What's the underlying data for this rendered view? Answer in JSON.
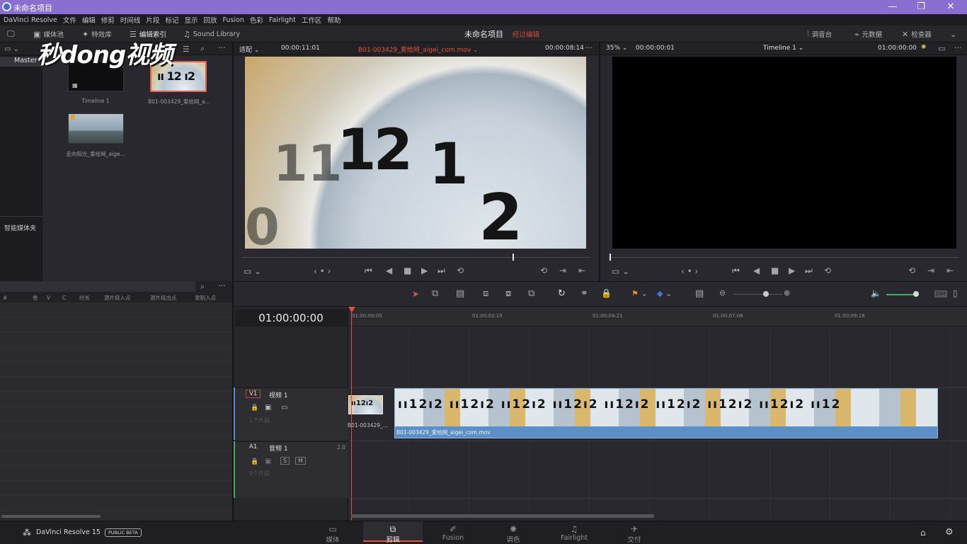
{
  "window": {
    "title": "未命名项目"
  },
  "menu": [
    "DaVinci Resolve",
    "文件",
    "编辑",
    "修剪",
    "时间线",
    "片段",
    "标记",
    "显示",
    "回放",
    "Fusion",
    "色彩",
    "Fairlight",
    "工作区",
    "帮助"
  ],
  "toolbar": {
    "media_pool": "媒体池",
    "effects": "特效库",
    "edit_index": "编辑索引",
    "sound_library": "Sound Library",
    "project": "未命名项目",
    "edited": "经过编辑",
    "mixer": "调音台",
    "metadata": "元数据",
    "inspector": "检查器"
  },
  "watermark": "秒懂视频",
  "bins": {
    "master": "Master",
    "smart": "智能媒体夹"
  },
  "media": [
    {
      "name": "Timeline 1"
    },
    {
      "name": "B01-003429_爱给网_a..."
    },
    {
      "name": "走向阳光_爱给网_aige..."
    }
  ],
  "source": {
    "fit": "适配",
    "tc": "00:00:11:01",
    "clip": "B01-003429_爱给网_aigei_com.mov",
    "dur": "00:00:08:14",
    "zoom": "35%",
    "tc2": "00:00:00:01"
  },
  "program": {
    "name": "Timeline 1",
    "tc": "01:00:00:00"
  },
  "edit_index_cols": [
    "#",
    "卷",
    "V",
    "C",
    "时长",
    "源片段入点",
    "源片段出点",
    "录制入点"
  ],
  "timeline": {
    "tc": "01:00:00:00",
    "ruler": [
      "01:00:00:00",
      "01:00:02:10",
      "01:00:04:21",
      "01:00:07:08",
      "01:00:09:18"
    ],
    "v1": {
      "id": "V1",
      "name": "视频 1",
      "count": "1个片段"
    },
    "a1": {
      "id": "A1",
      "name": "音频 1",
      "ch": "2.0",
      "count": "0个片段",
      "s": "S",
      "m": "M"
    },
    "clip": "B01-003429_爱给网_aigei_com.mov",
    "drag": "B01-003429_..."
  },
  "footer": {
    "app": "DaVinci Resolve 15",
    "beta": "PUBLIC BETA",
    "pages": [
      "媒体",
      "剪辑",
      "Fusion",
      "调色",
      "Fairlight",
      "交付"
    ]
  },
  "colors": {
    "accent": "#e0523a",
    "titlebar": "#8a6fd0",
    "clip": "#5b8fc6",
    "audio_line": "#3daa6e"
  }
}
